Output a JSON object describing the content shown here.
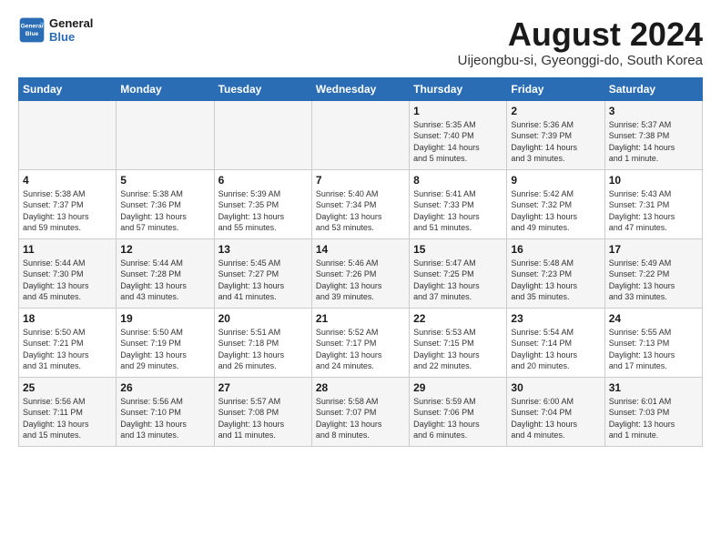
{
  "logo": {
    "line1": "General",
    "line2": "Blue"
  },
  "title": "August 2024",
  "subtitle": "Uijeongbu-si, Gyeonggi-do, South Korea",
  "weekdays": [
    "Sunday",
    "Monday",
    "Tuesday",
    "Wednesday",
    "Thursday",
    "Friday",
    "Saturday"
  ],
  "weeks": [
    [
      {
        "day": "",
        "info": ""
      },
      {
        "day": "",
        "info": ""
      },
      {
        "day": "",
        "info": ""
      },
      {
        "day": "",
        "info": ""
      },
      {
        "day": "1",
        "info": "Sunrise: 5:35 AM\nSunset: 7:40 PM\nDaylight: 14 hours\nand 5 minutes."
      },
      {
        "day": "2",
        "info": "Sunrise: 5:36 AM\nSunset: 7:39 PM\nDaylight: 14 hours\nand 3 minutes."
      },
      {
        "day": "3",
        "info": "Sunrise: 5:37 AM\nSunset: 7:38 PM\nDaylight: 14 hours\nand 1 minute."
      }
    ],
    [
      {
        "day": "4",
        "info": "Sunrise: 5:38 AM\nSunset: 7:37 PM\nDaylight: 13 hours\nand 59 minutes."
      },
      {
        "day": "5",
        "info": "Sunrise: 5:38 AM\nSunset: 7:36 PM\nDaylight: 13 hours\nand 57 minutes."
      },
      {
        "day": "6",
        "info": "Sunrise: 5:39 AM\nSunset: 7:35 PM\nDaylight: 13 hours\nand 55 minutes."
      },
      {
        "day": "7",
        "info": "Sunrise: 5:40 AM\nSunset: 7:34 PM\nDaylight: 13 hours\nand 53 minutes."
      },
      {
        "day": "8",
        "info": "Sunrise: 5:41 AM\nSunset: 7:33 PM\nDaylight: 13 hours\nand 51 minutes."
      },
      {
        "day": "9",
        "info": "Sunrise: 5:42 AM\nSunset: 7:32 PM\nDaylight: 13 hours\nand 49 minutes."
      },
      {
        "day": "10",
        "info": "Sunrise: 5:43 AM\nSunset: 7:31 PM\nDaylight: 13 hours\nand 47 minutes."
      }
    ],
    [
      {
        "day": "11",
        "info": "Sunrise: 5:44 AM\nSunset: 7:30 PM\nDaylight: 13 hours\nand 45 minutes."
      },
      {
        "day": "12",
        "info": "Sunrise: 5:44 AM\nSunset: 7:28 PM\nDaylight: 13 hours\nand 43 minutes."
      },
      {
        "day": "13",
        "info": "Sunrise: 5:45 AM\nSunset: 7:27 PM\nDaylight: 13 hours\nand 41 minutes."
      },
      {
        "day": "14",
        "info": "Sunrise: 5:46 AM\nSunset: 7:26 PM\nDaylight: 13 hours\nand 39 minutes."
      },
      {
        "day": "15",
        "info": "Sunrise: 5:47 AM\nSunset: 7:25 PM\nDaylight: 13 hours\nand 37 minutes."
      },
      {
        "day": "16",
        "info": "Sunrise: 5:48 AM\nSunset: 7:23 PM\nDaylight: 13 hours\nand 35 minutes."
      },
      {
        "day": "17",
        "info": "Sunrise: 5:49 AM\nSunset: 7:22 PM\nDaylight: 13 hours\nand 33 minutes."
      }
    ],
    [
      {
        "day": "18",
        "info": "Sunrise: 5:50 AM\nSunset: 7:21 PM\nDaylight: 13 hours\nand 31 minutes."
      },
      {
        "day": "19",
        "info": "Sunrise: 5:50 AM\nSunset: 7:19 PM\nDaylight: 13 hours\nand 29 minutes."
      },
      {
        "day": "20",
        "info": "Sunrise: 5:51 AM\nSunset: 7:18 PM\nDaylight: 13 hours\nand 26 minutes."
      },
      {
        "day": "21",
        "info": "Sunrise: 5:52 AM\nSunset: 7:17 PM\nDaylight: 13 hours\nand 24 minutes."
      },
      {
        "day": "22",
        "info": "Sunrise: 5:53 AM\nSunset: 7:15 PM\nDaylight: 13 hours\nand 22 minutes."
      },
      {
        "day": "23",
        "info": "Sunrise: 5:54 AM\nSunset: 7:14 PM\nDaylight: 13 hours\nand 20 minutes."
      },
      {
        "day": "24",
        "info": "Sunrise: 5:55 AM\nSunset: 7:13 PM\nDaylight: 13 hours\nand 17 minutes."
      }
    ],
    [
      {
        "day": "25",
        "info": "Sunrise: 5:56 AM\nSunset: 7:11 PM\nDaylight: 13 hours\nand 15 minutes."
      },
      {
        "day": "26",
        "info": "Sunrise: 5:56 AM\nSunset: 7:10 PM\nDaylight: 13 hours\nand 13 minutes."
      },
      {
        "day": "27",
        "info": "Sunrise: 5:57 AM\nSunset: 7:08 PM\nDaylight: 13 hours\nand 11 minutes."
      },
      {
        "day": "28",
        "info": "Sunrise: 5:58 AM\nSunset: 7:07 PM\nDaylight: 13 hours\nand 8 minutes."
      },
      {
        "day": "29",
        "info": "Sunrise: 5:59 AM\nSunset: 7:06 PM\nDaylight: 13 hours\nand 6 minutes."
      },
      {
        "day": "30",
        "info": "Sunrise: 6:00 AM\nSunset: 7:04 PM\nDaylight: 13 hours\nand 4 minutes."
      },
      {
        "day": "31",
        "info": "Sunrise: 6:01 AM\nSunset: 7:03 PM\nDaylight: 13 hours\nand 1 minute."
      }
    ]
  ]
}
